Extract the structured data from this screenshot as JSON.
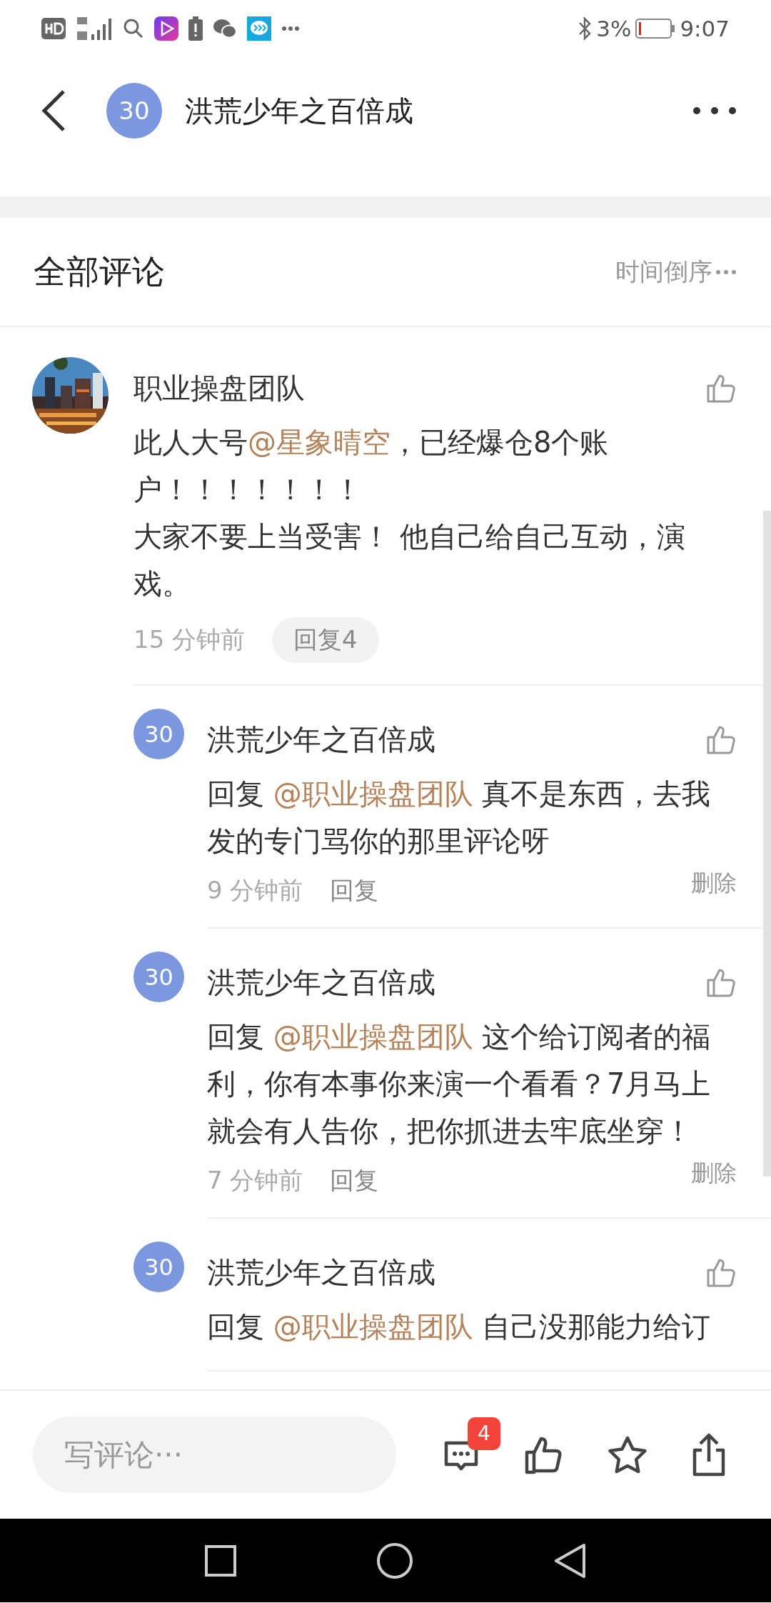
{
  "status_bar": {
    "battery": "3%",
    "time": "9:07"
  },
  "header": {
    "avatar_label": "30",
    "title": "洪荒少年之百倍成"
  },
  "comments_header": {
    "title": "全部评论",
    "sort": "时间倒序"
  },
  "comments": [
    {
      "author": "职业操盘团队",
      "avatar": {
        "kind": "picture"
      },
      "paragraphs": [
        [
          {
            "kind": "text",
            "text": "此人大号"
          },
          {
            "kind": "mention",
            "text": "@星象晴空"
          },
          {
            "kind": "text",
            "text": "，已经爆仓8个账户！！！！！！！"
          }
        ],
        [
          {
            "kind": "text",
            "text": "大家不要上当受害！ 他自己给自己互动，演戏。"
          }
        ]
      ],
      "time": "15 分钟前",
      "reply_button": "回复4",
      "replies": [
        {
          "author": "洪荒少年之百倍成",
          "avatar_label": "30",
          "body": [
            {
              "kind": "text",
              "text": "回复 "
            },
            {
              "kind": "mention",
              "text": "@职业操盘团队"
            },
            {
              "kind": "text",
              "text": " 真不是东西，去我发的专门骂你的那里评论呀"
            }
          ],
          "time": "9 分钟前",
          "reply_label": "回复",
          "delete_label": "删除"
        },
        {
          "author": "洪荒少年之百倍成",
          "avatar_label": "30",
          "body": [
            {
              "kind": "text",
              "text": "回复 "
            },
            {
              "kind": "mention",
              "text": "@职业操盘团队"
            },
            {
              "kind": "text",
              "text": " 这个给订阅者的福利，你有本事你来演一个看看？7月马上就会有人告你，把你抓进去牢底坐穿！"
            }
          ],
          "time": "7 分钟前",
          "reply_label": "回复",
          "delete_label": "删除"
        },
        {
          "author": "洪荒少年之百倍成",
          "avatar_label": "30",
          "body": [
            {
              "kind": "text",
              "text": "回复 "
            },
            {
              "kind": "mention",
              "text": "@职业操盘团队"
            },
            {
              "kind": "text",
              "text": " 自己没那能力给订"
            }
          ]
        }
      ]
    }
  ],
  "bottom_bar": {
    "placeholder": "写评论···",
    "comment_count": "4"
  }
}
